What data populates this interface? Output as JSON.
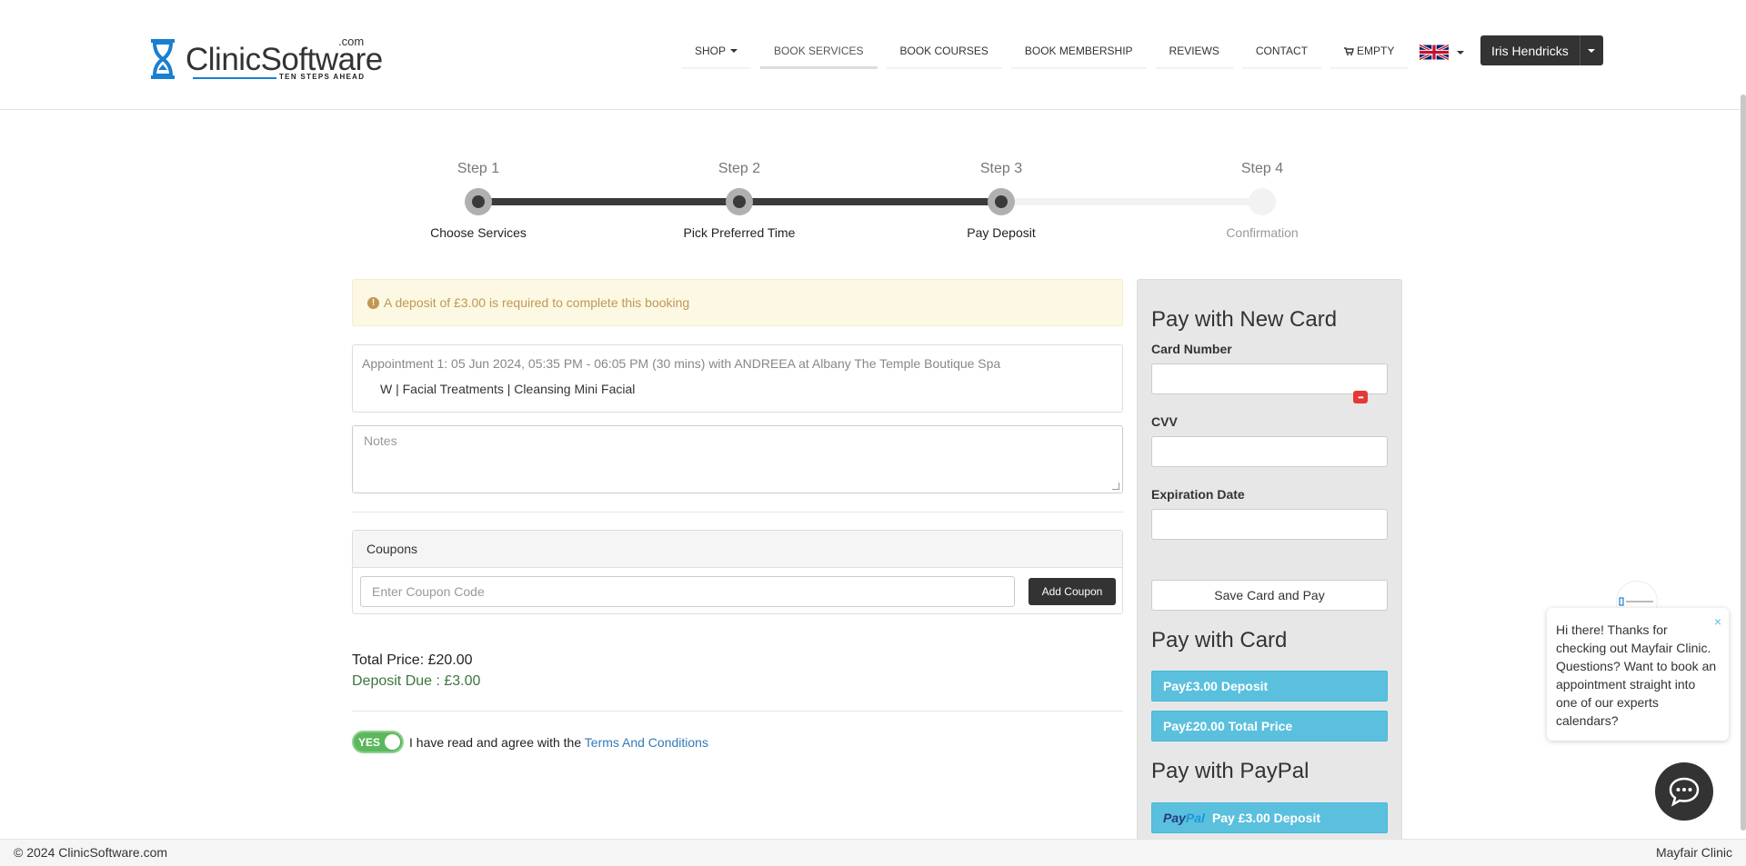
{
  "brand": {
    "name_part1": "Clinic",
    "name_part2": "Software",
    "dotcom": ".com",
    "tagline": "TEN STEPS AHEAD"
  },
  "nav": {
    "items": [
      {
        "label": "SHOP",
        "has_caret": true
      },
      {
        "label": "BOOK SERVICES",
        "active": true
      },
      {
        "label": "BOOK COURSES"
      },
      {
        "label": "BOOK MEMBERSHIP"
      },
      {
        "label": "REVIEWS"
      },
      {
        "label": "CONTACT"
      },
      {
        "label": "EMPTY",
        "icon": "cart-icon"
      }
    ],
    "language_icon": "uk-flag-icon",
    "user_name": "Iris Hendricks"
  },
  "steps": [
    {
      "title": "Step 1",
      "label": "Choose Services",
      "state": "done"
    },
    {
      "title": "Step 2",
      "label": "Pick Preferred Time",
      "state": "done"
    },
    {
      "title": "Step 3",
      "label": "Pay Deposit",
      "state": "current"
    },
    {
      "title": "Step 4",
      "label": "Confirmation",
      "state": "pending"
    }
  ],
  "booking": {
    "alert": "A deposit of £3.00 is required to complete this booking",
    "appointment": "Appointment 1:  05 Jun 2024, 05:35 PM - 06:05 PM (30 mins) with ANDREEA at Albany The Temple Boutique Spa",
    "service": "W | Facial Treatments | Cleansing Mini Facial",
    "notes_placeholder": "Notes",
    "coupons_title": "Coupons",
    "coupon_placeholder": "Enter Coupon Code",
    "coupon_button": "Add Coupon",
    "total_price": "Total Price: £20.00",
    "deposit_due": "Deposit Due : £3.00",
    "toggle_label": "YES",
    "terms_text": "I have read and agree with the",
    "terms_link": "Terms And Conditions"
  },
  "payment": {
    "new_card_title": "Pay with New Card",
    "card_number_label": "Card Number",
    "cvv_label": "CVV",
    "expiry_label": "Expiration Date",
    "save_button": "Save Card and Pay",
    "card_title": "Pay with Card",
    "pay_deposit_button": "Pay£3.00 Deposit",
    "pay_total_button": "Pay£20.00 Total Price",
    "paypal_title": "Pay with PayPal",
    "paypal_logo_1": "Pay",
    "paypal_logo_2": "Pal",
    "paypal_button": "Pay £3.00 Deposit"
  },
  "chat": {
    "message": "Hi there! Thanks for checking out Mayfair Clinic. Questions? Want to book an appointment straight into one of our experts calendars?",
    "close": "×"
  },
  "footer": {
    "copyright": "© 2024 ClinicSoftware.com",
    "clinic": "Mayfair Clinic"
  },
  "colors": {
    "accent": "#5bc0de",
    "dark": "#333333",
    "success": "#3c763d",
    "warning_bg": "#fcf8e3",
    "warning_text": "#c09853"
  }
}
